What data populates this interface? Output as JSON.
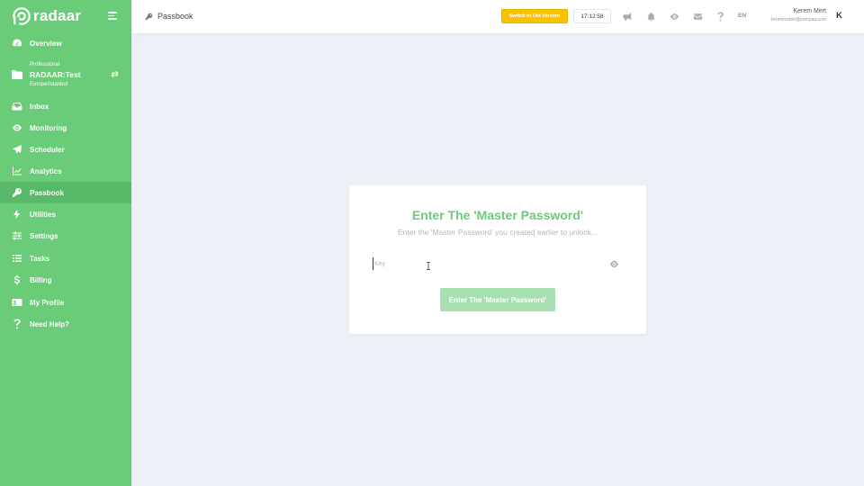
{
  "brand": {
    "name": "radaar",
    "logo_icon": "radaar-logo-icon"
  },
  "account": {
    "plan": "Professional",
    "name": "RADAAR:Test",
    "timezone": "Europe/Istanbul"
  },
  "sidebar": {
    "items": [
      {
        "label": "Overview",
        "icon": "dashboard-icon"
      },
      {
        "label": "Inbox",
        "icon": "inbox-icon"
      },
      {
        "label": "Monitoring",
        "icon": "eye-icon"
      },
      {
        "label": "Scheduler",
        "icon": "paper-plane-icon"
      },
      {
        "label": "Analytics",
        "icon": "chart-line-icon"
      },
      {
        "label": "Passbook",
        "icon": "key-icon",
        "active": true
      },
      {
        "label": "Utilities",
        "icon": "bolt-icon"
      },
      {
        "label": "Settings",
        "icon": "sliders-icon"
      },
      {
        "label": "Tasks",
        "icon": "list-icon"
      },
      {
        "label": "Billing",
        "icon": "dollar-icon"
      },
      {
        "label": "My Profile",
        "icon": "id-card-icon"
      },
      {
        "label": "Need Help?",
        "icon": "question-icon"
      }
    ]
  },
  "header": {
    "page_title": "Passbook",
    "old_version_label": "Switch to Old Version",
    "time": "17:12:58",
    "language": "EN",
    "user_name": "Kerem Mert",
    "user_email": "keremozden@pompaa.com",
    "user_initial": "K",
    "icons": [
      "megaphone-icon",
      "bell-icon",
      "eye-icon",
      "envelope-icon",
      "question-icon"
    ]
  },
  "unlock": {
    "title": "Enter The 'Master Password'",
    "subtitle": "Enter the 'Master Password' you created earlier to unlock...",
    "placeholder": "Key",
    "value": "",
    "button_label": "Enter The 'Master Password'"
  },
  "colors": {
    "brand_green": "#6acb78",
    "active_green": "#58ba68",
    "button_disabled_green": "#a7e0b0",
    "warning_yellow": "#f8c400",
    "background": "#edf0f7"
  }
}
